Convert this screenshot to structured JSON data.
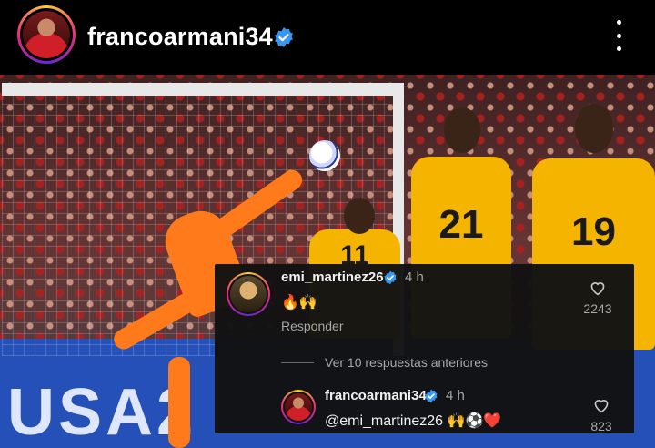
{
  "header": {
    "username": "francoarmani34",
    "avatar_icon": "profile-avatar",
    "verified_icon": "verified-badge-icon",
    "more_icon": "more-options-icon"
  },
  "photo": {
    "banner_text": "USA2",
    "jersey_numbers": [
      "11",
      "21",
      "19"
    ]
  },
  "comments": {
    "top": {
      "username": "emi_martinez26",
      "time": "4 h",
      "text": "🔥🙌",
      "reply_label": "Responder",
      "likes": "2243"
    },
    "view_more": "Ver 10 respuestas anteriores",
    "reply": {
      "username": "francoarmani34",
      "time": "4 h",
      "text": "@emi_martinez26 🙌⚽❤️",
      "likes": "823"
    }
  },
  "colors": {
    "background": "#000000",
    "verified": "#3897f0",
    "comment_panel": "#121212",
    "muted_text": "#a8a8a8"
  }
}
